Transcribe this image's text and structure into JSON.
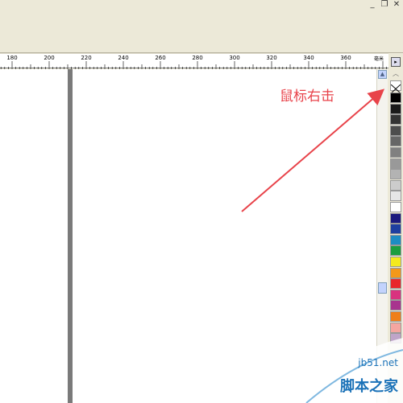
{
  "window": {
    "minimize_label": "_",
    "restore_label": "❐",
    "close_label": "✕"
  },
  "ruler": {
    "labels": [
      "180",
      "200",
      "220",
      "240",
      "260",
      "280",
      "300",
      "320",
      "340",
      "360"
    ],
    "unit_label": "毫米"
  },
  "palette": {
    "colors": [
      "#000000",
      "#1a1a1a",
      "#333333",
      "#4d4d4d",
      "#666666",
      "#808080",
      "#999999",
      "#b3b3b3",
      "#cccccc",
      "#e6e6e6",
      "#ffffff",
      "#1b1a7e",
      "#1e3fa0",
      "#1d8cc3",
      "#1c9d3f",
      "#f4e91e",
      "#f39819",
      "#e8262b",
      "#d8337f",
      "#a8348e",
      "#ef7f1a",
      "#f4a6a0",
      "#bfa5c9"
    ]
  },
  "annotation": {
    "text": "鼠标右击"
  },
  "watermark": {
    "domain": "jb51.net",
    "site": "脚本之家"
  }
}
